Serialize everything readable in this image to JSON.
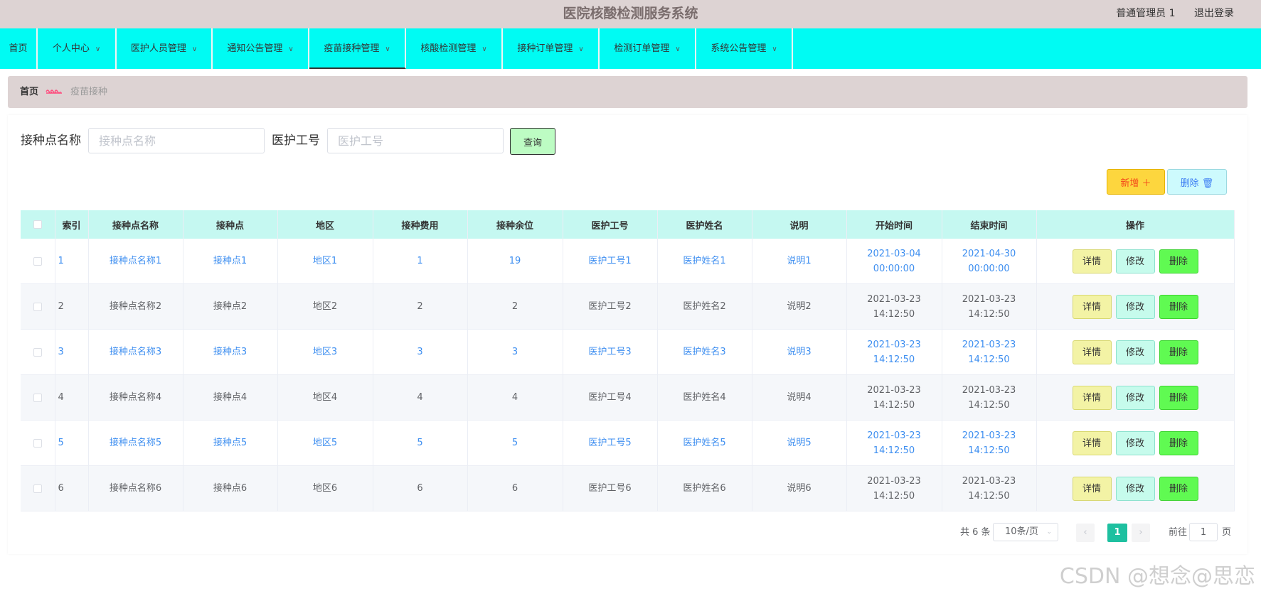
{
  "header": {
    "title": "医院核酸检测服务系统",
    "user": "普通管理员 1",
    "logout": "退出登录"
  },
  "nav": [
    {
      "label": "首页",
      "has_menu": false
    },
    {
      "label": "个人中心",
      "has_menu": true
    },
    {
      "label": "医护人员管理",
      "has_menu": true
    },
    {
      "label": "通知公告管理",
      "has_menu": true
    },
    {
      "label": "疫苗接种管理",
      "has_menu": true,
      "active": true
    },
    {
      "label": "核酸检测管理",
      "has_menu": true
    },
    {
      "label": "接种订单管理",
      "has_menu": true
    },
    {
      "label": "检测订单管理",
      "has_menu": true
    },
    {
      "label": "系统公告管理",
      "has_menu": true
    }
  ],
  "breadcrumb": {
    "home": "首页",
    "current": "疫苗接种"
  },
  "search": {
    "name_label": "接种点名称",
    "name_placeholder": "接种点名称",
    "staff_label": "医护工号",
    "staff_placeholder": "医护工号",
    "query_button": "查询"
  },
  "toolbar": {
    "add_label": "新增 ＋",
    "delete_label": "删除 🗑"
  },
  "table": {
    "headers": [
      "",
      "索引",
      "接种点名称",
      "接种点",
      "地区",
      "接种费用",
      "接种余位",
      "医护工号",
      "医护姓名",
      "说明",
      "开始时间",
      "结束时间",
      "操作"
    ],
    "rows": [
      [
        "1",
        "接种点名称1",
        "接种点1",
        "地区1",
        "1",
        "19",
        "医护工号1",
        "医护姓名1",
        "说明1",
        "2021-03-04 00:00:00",
        "2021-04-30 00:00:00"
      ],
      [
        "2",
        "接种点名称2",
        "接种点2",
        "地区2",
        "2",
        "2",
        "医护工号2",
        "医护姓名2",
        "说明2",
        "2021-03-23 14:12:50",
        "2021-03-23 14:12:50"
      ],
      [
        "3",
        "接种点名称3",
        "接种点3",
        "地区3",
        "3",
        "3",
        "医护工号3",
        "医护姓名3",
        "说明3",
        "2021-03-23 14:12:50",
        "2021-03-23 14:12:50"
      ],
      [
        "4",
        "接种点名称4",
        "接种点4",
        "地区4",
        "4",
        "4",
        "医护工号4",
        "医护姓名4",
        "说明4",
        "2021-03-23 14:12:50",
        "2021-03-23 14:12:50"
      ],
      [
        "5",
        "接种点名称5",
        "接种点5",
        "地区5",
        "5",
        "5",
        "医护工号5",
        "医护姓名5",
        "说明5",
        "2021-03-23 14:12:50",
        "2021-03-23 14:12:50"
      ],
      [
        "6",
        "接种点名称6",
        "接种点6",
        "地区6",
        "6",
        "6",
        "医护工号6",
        "医护姓名6",
        "说明6",
        "2021-03-23 14:12:50",
        "2021-03-23 14:12:50"
      ]
    ],
    "actions": {
      "detail": "详情",
      "edit": "修改",
      "delete": "删除"
    }
  },
  "pagination": {
    "total": "共 6 条",
    "page_size": "10条/页",
    "current_page": "1",
    "goto_prefix": "前往",
    "goto_value": "1",
    "goto_suffix": "页"
  },
  "watermark": "CSDN @想念@思恋",
  "icons": {
    "chevron": "chevron-down-icon",
    "breadcrumb_separator": "heart-chain-icon",
    "prev": "chevron-left-icon",
    "next": "chevron-right-icon"
  },
  "colors": {
    "nav_bg": "#00fbf3",
    "header_bg": "#ddd3d3",
    "table_header_bg": "#c5f8f1",
    "link_blue": "#3d8ef0",
    "page_active": "#1ec0a0"
  }
}
